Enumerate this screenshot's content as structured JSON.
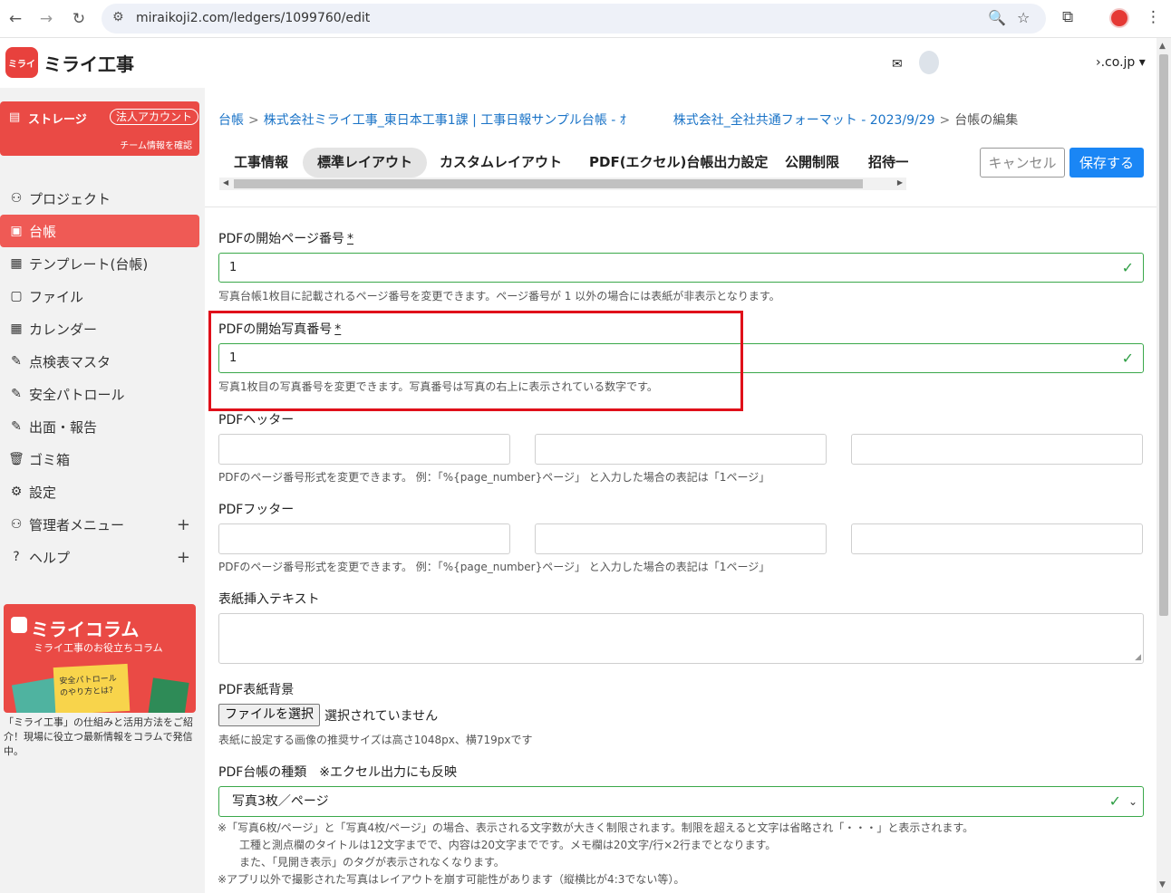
{
  "browser": {
    "url": "miraikoji2.com/ledgers/1099760/edit",
    "back_icon": "←",
    "forward_icon": "→",
    "reload_icon": "↻",
    "site_info_icon": "⚙",
    "zoom_icon": "🔍",
    "star_icon": "☆",
    "extensions_icon": "⧉",
    "menu_icon": "⋮"
  },
  "app": {
    "logo_mark": "ミライ",
    "logo_text": "ミライ工事"
  },
  "sidebar": {
    "storage": {
      "icon": "▤",
      "label": "ストレージ",
      "badge": "法人アカウント",
      "sub": "チーム情報を確認"
    },
    "items": [
      {
        "icon": "⚇",
        "label": "プロジェクト",
        "active": false
      },
      {
        "icon": "▣",
        "label": "台帳",
        "active": true
      },
      {
        "icon": "▦",
        "label": "テンプレート(台帳)",
        "active": false
      },
      {
        "icon": "▢",
        "label": "ファイル",
        "active": false
      },
      {
        "icon": "▦",
        "label": "カレンダー",
        "active": false
      },
      {
        "icon": "✎",
        "label": "点検表マスタ",
        "active": false
      },
      {
        "icon": "✎",
        "label": "安全パトロール",
        "active": false
      },
      {
        "icon": "✎",
        "label": "出面・報告",
        "active": false
      },
      {
        "icon": "🗑",
        "label": "ゴミ箱",
        "active": false
      },
      {
        "icon": "⚙",
        "label": "設定",
        "active": false
      },
      {
        "icon": "⚇",
        "label": "管理者メニュー",
        "active": false,
        "plus": "+"
      },
      {
        "icon": "?",
        "label": "ヘルプ",
        "active": false,
        "plus": "+"
      }
    ],
    "banner": {
      "title": "ミライコラム",
      "sub": "ミライ工事のお役立ちコラム",
      "card_text": "安全パトロールのやり方とは?",
      "desc": "「ミライ工事」の仕組みと活用方法をご紹介！現場に役立つ最新情報をコラムで発信中。"
    }
  },
  "header": {
    "inbox_icon": "✉",
    "account": "›.co.jp ▾"
  },
  "breadcrumb": {
    "root": "台帳",
    "project": "株式会社ミライ工事_東日本工事1課 | 工事日報サンプル台帳 - ｵ",
    "template": "株式会社_全社共通フォーマット - 2023/9/29",
    "current": "台帳の編集",
    "sep": ">"
  },
  "tabs": [
    {
      "label": "工事情報",
      "active": false
    },
    {
      "label": "標準レイアウト",
      "active": true
    },
    {
      "label": "カスタムレイアウト",
      "active": false
    },
    {
      "label": "PDF(エクセル)台帳出力設定",
      "active": false
    },
    {
      "label": "公開制限",
      "active": false
    },
    {
      "label": "招待一",
      "active": false
    }
  ],
  "actions": {
    "cancel": "キャンセル",
    "save": "保存する"
  },
  "form": {
    "start_page": {
      "label": "PDFの開始ページ番号",
      "req": "*",
      "value": "1",
      "help": "写真台帳1枚目に記載されるページ番号を変更できます。ページ番号が 1 以外の場合には表紙が非表示となります。"
    },
    "start_photo": {
      "label": "PDFの開始写真番号",
      "req": "*",
      "value": "1",
      "help": "写真1枚目の写真番号を変更できます。写真番号は写真の右上に表示されている数字です。"
    },
    "header": {
      "label": "PDFヘッター",
      "help": "PDFのページ番号形式を変更できます。 例：「%{page_number}ページ」 と入力した場合の表記は「1ページ」"
    },
    "footer": {
      "label": "PDFフッター",
      "help": "PDFのページ番号形式を変更できます。 例：「%{page_number}ページ」 と入力した場合の表記は「1ページ」"
    },
    "cover_text": {
      "label": "表紙挿入テキスト"
    },
    "cover_bg": {
      "label": "PDF表紙背景",
      "button": "ファイルを選択",
      "status": "選択されていません",
      "help": "表紙に設定する画像の推奨サイズは高さ1048px、横719pxです"
    },
    "ledger_type": {
      "label": "PDF台帳の種類　※エクセル出力にも反映",
      "value": "写真3枚／ページ",
      "notes": [
        "※「写真6枚/ページ」と「写真4枚/ページ」の場合、表示される文字数が大きく制限されます。制限を超えると文字は省略され「・・・」と表示されます。",
        "　　工種と測点欄のタイトルは12文字までで、内容は20文字までです。メモ欄は20文字/行×2行までとなります。",
        "　　また、「見開き表示」のタグが表示されなくなります。",
        "※アプリ以外で撮影された写真はレイアウトを崩す可能性があります（縦横比が4:3でない等）。"
      ]
    }
  },
  "colors": {
    "accent": "#1a86f5",
    "brand": "#ea4a45",
    "valid": "#3aa84a",
    "highlight": "#e0101a"
  }
}
